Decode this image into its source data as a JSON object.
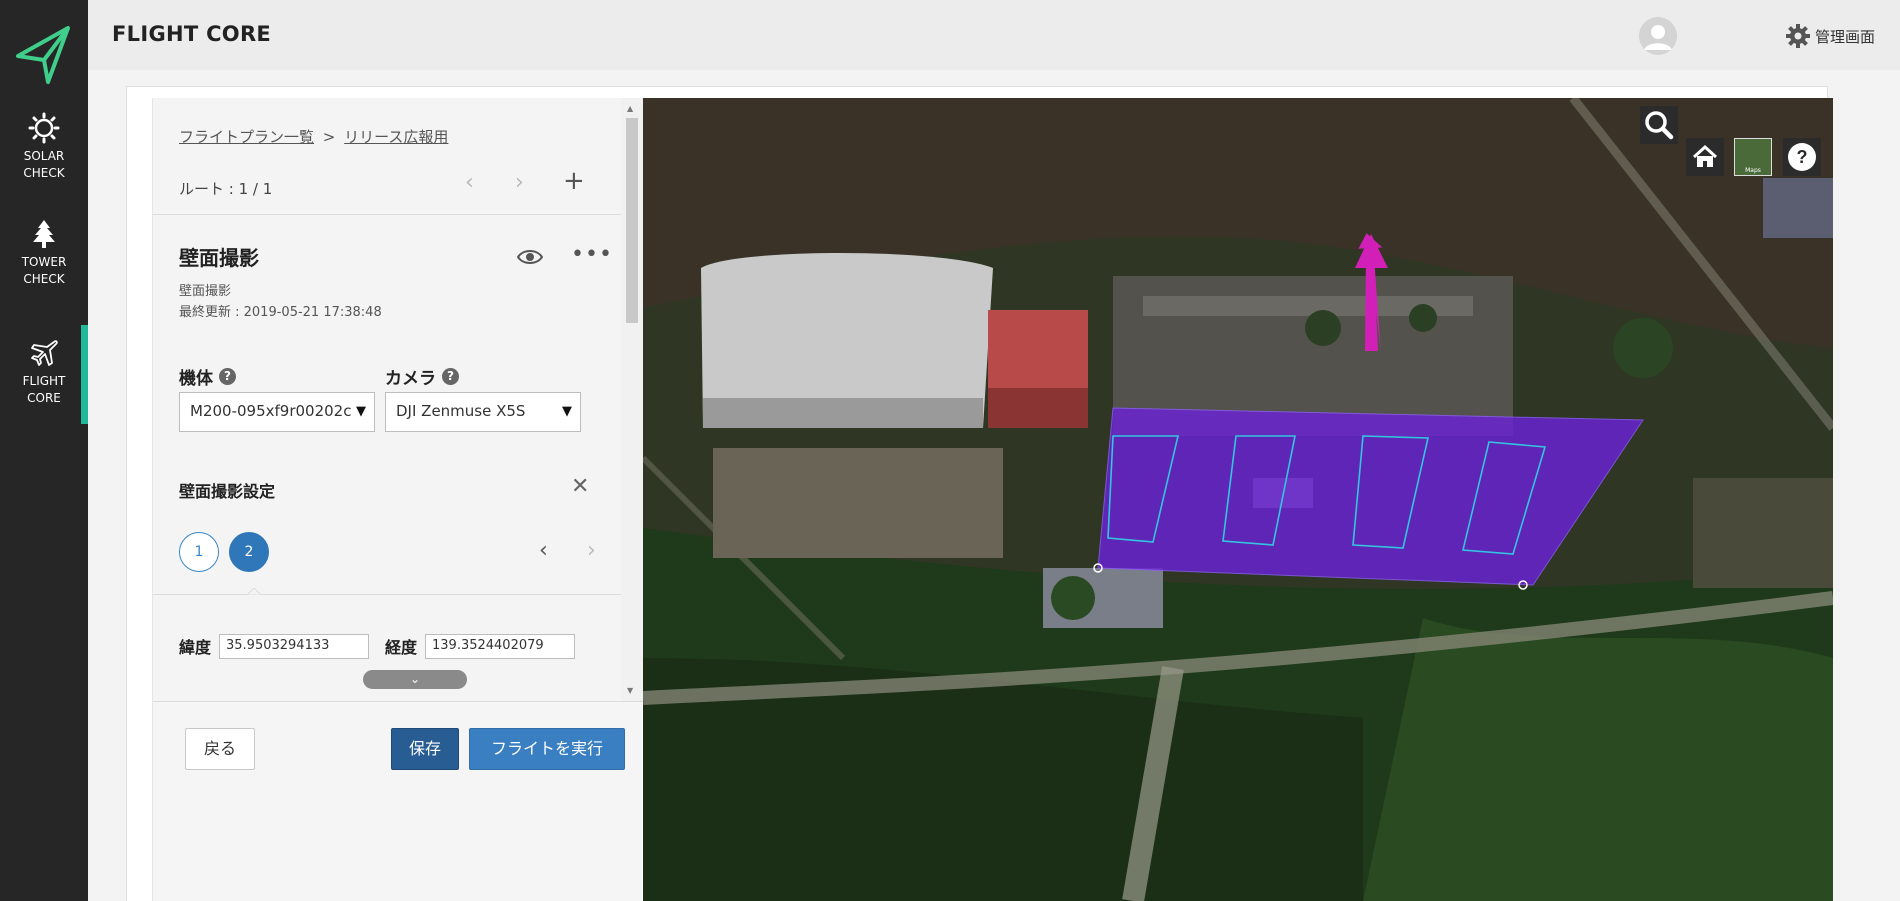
{
  "app": {
    "brand": "FLIGHT CORE",
    "admin_label": "管理画面"
  },
  "sidebar": {
    "items": [
      {
        "label1": "SOLAR",
        "label2": "CHECK"
      },
      {
        "label1": "TOWER",
        "label2": "CHECK"
      },
      {
        "label1": "FLIGHT",
        "label2": "CORE"
      }
    ],
    "accent_color": "#22b89a"
  },
  "panel": {
    "breadcrumb": {
      "list_link": "フライトプラン一覧",
      "separator": ">",
      "current": "リリース広報用"
    },
    "route_label": "ルート : 1 / 1",
    "plan": {
      "title": "壁面撮影",
      "subtitle": "壁面撮影",
      "updated": "最終更新 : 2019-05-21 17:38:48"
    },
    "aircraft": {
      "label": "機体",
      "value": "M200-095xf9r00202c"
    },
    "camera": {
      "label": "カメラ",
      "value": "DJI Zenmuse X5S"
    },
    "settings_title": "壁面撮影設定",
    "steps": [
      "1",
      "2"
    ],
    "latitude": {
      "label": "緯度",
      "value": "35.9503294133"
    },
    "longitude": {
      "label": "経度",
      "value": "139.3524402079"
    },
    "buttons": {
      "back": "戻る",
      "save": "保存",
      "run": "フライトを実行"
    }
  },
  "map": {
    "layer_thumb_label": "Maps",
    "area_color": "#6a22d6",
    "arrow_color": "#d21fb8"
  }
}
